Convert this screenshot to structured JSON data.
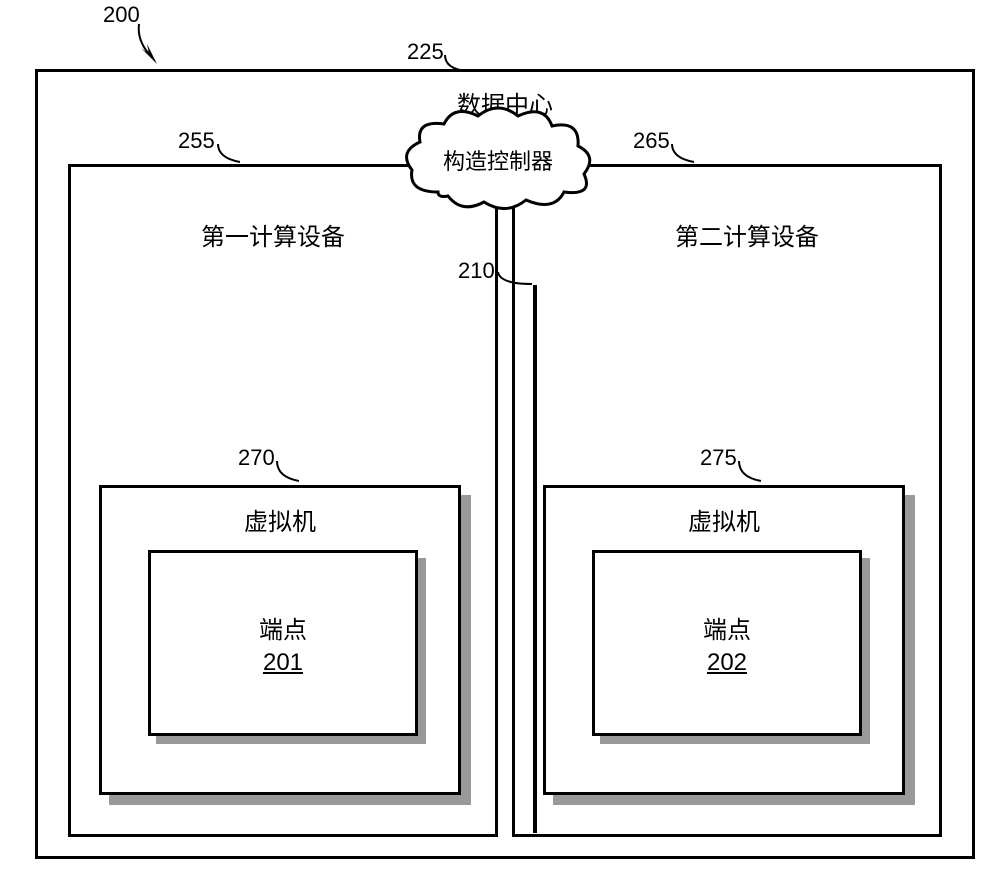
{
  "refs": {
    "system": "200",
    "datacenter": "225",
    "device1": "255",
    "device2": "265",
    "controller": "210",
    "vm1": "270",
    "vm2": "275"
  },
  "labels": {
    "datacenter": "数据中心",
    "device1": "第一计算设备",
    "device2": "第二计算设备",
    "controller": "构造控制器",
    "vm": "虚拟机",
    "endpoint": "端点",
    "ep1": "201",
    "ep2": "202"
  }
}
